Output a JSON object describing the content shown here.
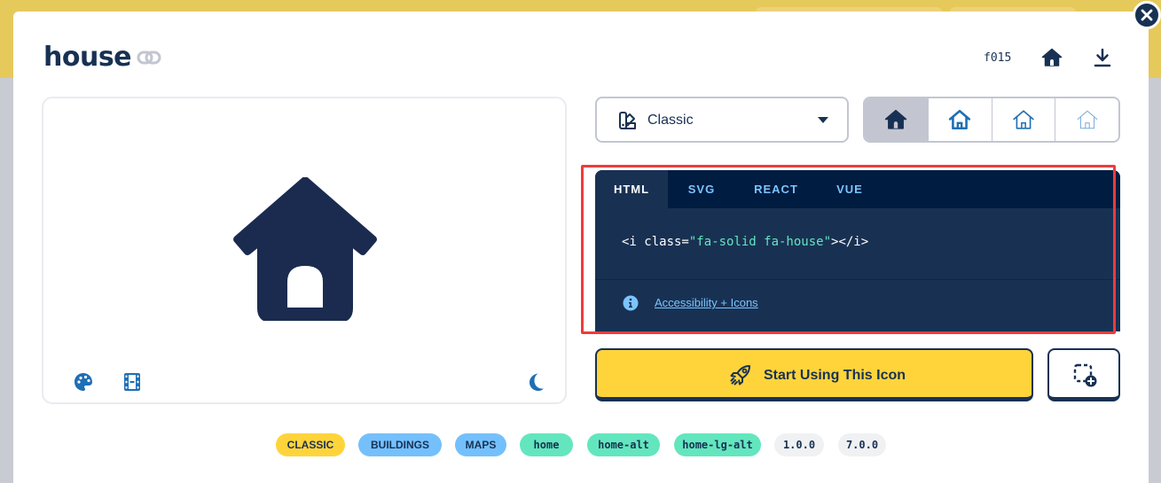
{
  "icon": {
    "name": "house",
    "unicode": "f015"
  },
  "style_select": {
    "label": "Classic"
  },
  "code": {
    "tabs": [
      "HTML",
      "SVG",
      "REACT",
      "VUE"
    ],
    "active_tab": "HTML",
    "snippet_prefix": "<i class=",
    "snippet_value": "\"fa-solid fa-house\"",
    "snippet_suffix": "></i>",
    "a11y_link": "Accessibility + Icons"
  },
  "cta": {
    "label": "Start Using This Icon"
  },
  "tags": [
    "CLASSIC",
    "BUILDINGS",
    "MAPS",
    "home",
    "home-alt",
    "home-lg-alt",
    "1.0.0",
    "7.0.0"
  ],
  "colors": {
    "navy": "#183153",
    "yellow": "#ffd43b",
    "blue_tag": "#74c0fc",
    "green_tag": "#63e6be",
    "grey_tag": "#f0f1f3",
    "highlight": "#ef3b3b"
  }
}
